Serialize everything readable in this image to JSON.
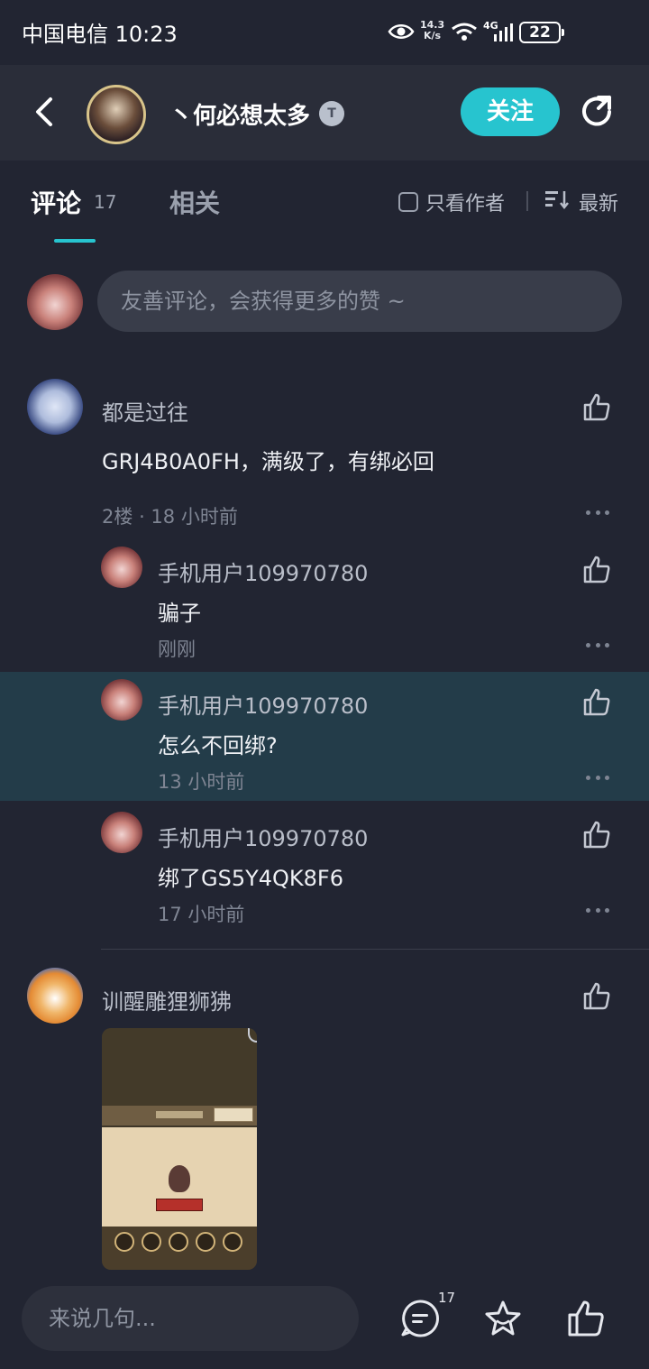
{
  "status_bar": {
    "carrier_time": "中国电信 10:23",
    "net_speed_value": "14.3",
    "net_speed_unit": "K/s",
    "network": "4G",
    "battery": "22"
  },
  "header": {
    "user_name": "丶何必想太多",
    "badge": "T",
    "follow_label": "关注"
  },
  "tabs": {
    "comments_label": "评论",
    "comments_count": "17",
    "related_label": "相关",
    "author_only_label": "只看作者",
    "sort_label": "最新"
  },
  "comment_box": {
    "placeholder": "友善评论，会获得更多的赞 ~"
  },
  "comments": [
    {
      "user": "都是过往",
      "content": "GRJ4B0A0FH，满级了，有绑必回",
      "floor": "2楼",
      "time": "18 小时前",
      "replies": [
        {
          "user": "手机用户109970780",
          "content": "骗子",
          "time": "刚刚"
        },
        {
          "user": "手机用户109970780",
          "content": "怎么不回绑?",
          "time": "13 小时前"
        },
        {
          "user": "手机用户109970780",
          "content": "绑了GS5Y4QK8F6",
          "time": "17 小时前"
        }
      ]
    },
    {
      "user": "训醒雕狸狮狒"
    }
  ],
  "bottom_bar": {
    "placeholder": "来说几句...",
    "comment_count": "17"
  },
  "colors": {
    "background": "#222532",
    "accent": "#27c4cf",
    "highlight_row": "#233c49"
  }
}
